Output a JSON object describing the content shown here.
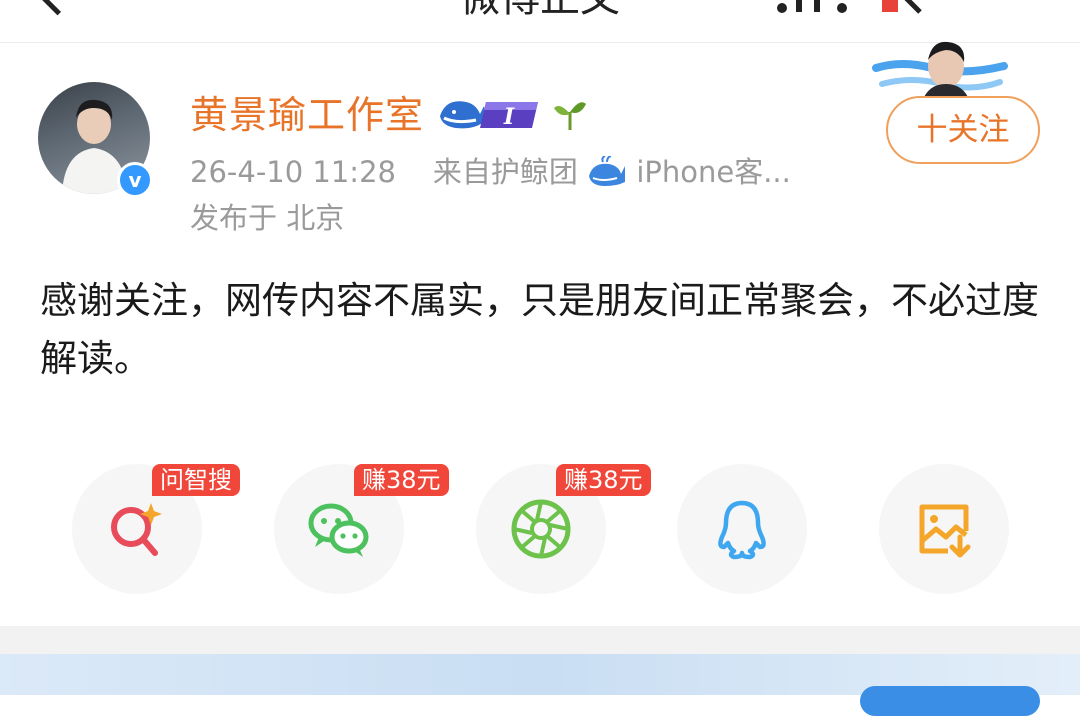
{
  "topbar": {
    "title": "微博正文"
  },
  "author": {
    "name": "黄景瑜工作室",
    "verified_mark": "v",
    "badge_level": "I"
  },
  "meta": {
    "time": "26-4-10 11:28",
    "source_prefix": "来自护鲸团",
    "source_suffix": "iPhone客...",
    "location": "发布于 北京"
  },
  "follow_button": {
    "label": "十关注"
  },
  "post": {
    "text": "感谢关注，网传内容不属实，只是朋友间正常聚会，不必过度解读。"
  },
  "share": {
    "items": [
      {
        "icon": "ai-search-icon",
        "badge": "问智搜",
        "color": "#e84c5a"
      },
      {
        "icon": "wechat-icon",
        "badge": "赚38元",
        "color": "#4cc15d"
      },
      {
        "icon": "moments-icon",
        "badge": "赚38元",
        "color": "#6cc24a"
      },
      {
        "icon": "qq-icon",
        "badge": "",
        "color": "#3fa6f0"
      },
      {
        "icon": "save-image-icon",
        "badge": "",
        "color": "#f4a62a"
      }
    ]
  },
  "colors": {
    "accent": "#e8742a",
    "badge_red": "#f0473a",
    "meta_gray": "#9a9a9a"
  }
}
